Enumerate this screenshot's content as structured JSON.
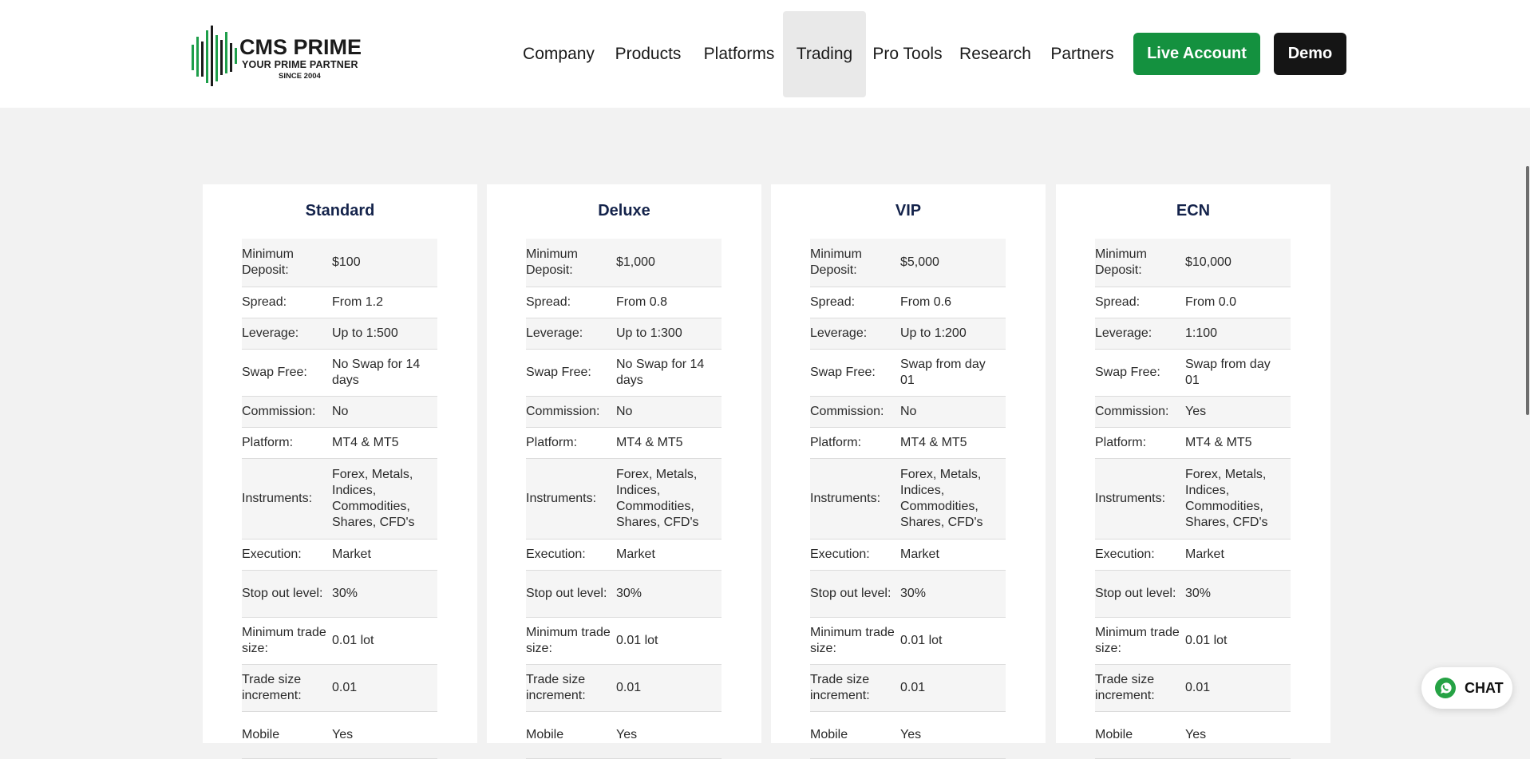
{
  "logo": {
    "title": "CMS PRIME",
    "tagline": "YOUR PRIME PARTNER",
    "since": "SINCE 2004",
    "bar_color": "#1e9e4a"
  },
  "nav": {
    "items": [
      {
        "label": "Company"
      },
      {
        "label": "Products"
      },
      {
        "label": "Platforms"
      },
      {
        "label": "Trading",
        "active": true
      },
      {
        "label": "Pro Tools"
      },
      {
        "label": "Research"
      },
      {
        "label": "Partners"
      }
    ],
    "live_account": "Live Account",
    "demo": "Demo"
  },
  "colors": {
    "accent_green": "#14913f",
    "title_navy": "#14234b",
    "demo_black": "#151515"
  },
  "accounts": [
    {
      "title": "Standard",
      "rows": [
        {
          "label": "Minimum Deposit:",
          "value": "$100"
        },
        {
          "label": "Spread:",
          "value": "From 1.2"
        },
        {
          "label": "Leverage:",
          "value": "Up to 1:500"
        },
        {
          "label": "Swap Free:",
          "value": "No Swap for 14 days"
        },
        {
          "label": "Commission:",
          "value": "No"
        },
        {
          "label": "Platform:",
          "value": "MT4 & MT5"
        },
        {
          "label": "Instruments:",
          "value": "Forex, Metals, Indices, Commodities, Shares, CFD's"
        },
        {
          "label": "Execution:",
          "value": "Market"
        },
        {
          "label": "Stop out level:",
          "value": "30%"
        },
        {
          "label": "Minimum trade size:",
          "value": "0.01 lot"
        },
        {
          "label": "Trade size increment:",
          "value": "0.01"
        },
        {
          "label": "Mobile",
          "value": "Yes"
        }
      ]
    },
    {
      "title": "Deluxe",
      "rows": [
        {
          "label": "Minimum Deposit:",
          "value": "$1,000"
        },
        {
          "label": "Spread:",
          "value": "From 0.8"
        },
        {
          "label": "Leverage:",
          "value": "Up to 1:300"
        },
        {
          "label": "Swap Free:",
          "value": "No Swap for 14 days"
        },
        {
          "label": "Commission:",
          "value": "No"
        },
        {
          "label": "Platform:",
          "value": "MT4 & MT5"
        },
        {
          "label": "Instruments:",
          "value": "Forex, Metals, Indices, Commodities, Shares, CFD's"
        },
        {
          "label": "Execution:",
          "value": "Market"
        },
        {
          "label": "Stop out level:",
          "value": "30%"
        },
        {
          "label": "Minimum trade size:",
          "value": "0.01 lot"
        },
        {
          "label": "Trade size increment:",
          "value": "0.01"
        },
        {
          "label": "Mobile",
          "value": "Yes"
        }
      ]
    },
    {
      "title": "VIP",
      "rows": [
        {
          "label": "Minimum Deposit:",
          "value": "$5,000"
        },
        {
          "label": "Spread:",
          "value": "From 0.6"
        },
        {
          "label": "Leverage:",
          "value": "Up to 1:200"
        },
        {
          "label": "Swap Free:",
          "value": "Swap from day 01"
        },
        {
          "label": "Commission:",
          "value": "No"
        },
        {
          "label": "Platform:",
          "value": "MT4 & MT5"
        },
        {
          "label": "Instruments:",
          "value": "Forex, Metals, Indices, Commodities, Shares, CFD's"
        },
        {
          "label": "Execution:",
          "value": "Market"
        },
        {
          "label": "Stop out level:",
          "value": "30%"
        },
        {
          "label": "Minimum trade size:",
          "value": "0.01 lot"
        },
        {
          "label": "Trade size increment:",
          "value": "0.01"
        },
        {
          "label": "Mobile",
          "value": "Yes"
        }
      ]
    },
    {
      "title": "ECN",
      "rows": [
        {
          "label": "Minimum Deposit:",
          "value": "$10,000"
        },
        {
          "label": "Spread:",
          "value": "From 0.0"
        },
        {
          "label": "Leverage:",
          "value": " 1:100"
        },
        {
          "label": "Swap Free:",
          "value": "Swap from day 01"
        },
        {
          "label": "Commission:",
          "value": "Yes"
        },
        {
          "label": "Platform:",
          "value": "MT4 & MT5"
        },
        {
          "label": "Instruments:",
          "value": "Forex, Metals, Indices, Commodities, Shares, CFD's"
        },
        {
          "label": "Execution:",
          "value": "Market"
        },
        {
          "label": "Stop out level:",
          "value": "30%"
        },
        {
          "label": "Minimum trade size:",
          "value": "0.01 lot"
        },
        {
          "label": "Trade size increment:",
          "value": "0.01"
        },
        {
          "label": "Mobile",
          "value": "Yes"
        }
      ]
    }
  ],
  "chat": {
    "label": "CHAT",
    "icon": "whatsapp-icon"
  }
}
